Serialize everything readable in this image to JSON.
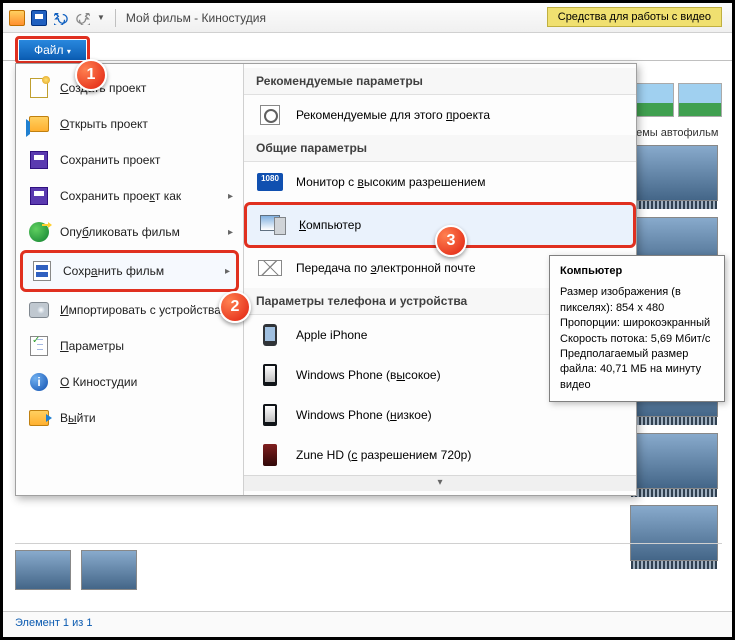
{
  "title": "Мой фильм - Киностудия",
  "tool_tab": "Средства для работы с видео",
  "file_button": "Файл",
  "thumbs_header": "Темы автофильм",
  "status": "Элемент 1 из 1",
  "file_menu": {
    "left": [
      {
        "id": "new",
        "label": "Создать проект",
        "u": "С"
      },
      {
        "id": "open",
        "label": "Открыть проект",
        "u": "О"
      },
      {
        "id": "save",
        "label": "Сохранить проект"
      },
      {
        "id": "saveas",
        "label": "Сохранить проект как",
        "u": "к",
        "arrow": true
      },
      {
        "id": "publish",
        "label": "Опубликовать фильм",
        "u": "б",
        "arrow": true
      },
      {
        "id": "savefilm",
        "label": "Сохранить фильм",
        "u": "а",
        "arrow": true,
        "hl": true
      },
      {
        "id": "import",
        "label": "Импортировать с устройства",
        "u": "И"
      },
      {
        "id": "settings",
        "label": "Параметры",
        "u": "П"
      },
      {
        "id": "about",
        "label": "О Киностудии",
        "u": "О"
      },
      {
        "id": "exit",
        "label": "Выйти",
        "u": "ы"
      }
    ],
    "sections": [
      {
        "title": "Рекомендуемые параметры",
        "items": [
          {
            "id": "recommended",
            "label": "Рекомендуемые для этого проекта",
            "u": "п"
          }
        ]
      },
      {
        "title": "Общие параметры",
        "items": [
          {
            "id": "hd",
            "label": "Монитор с высоким разрешением",
            "u": "в"
          },
          {
            "id": "computer",
            "label": "Компьютер",
            "u": "К",
            "hl": true
          },
          {
            "id": "email",
            "label": "Передача по электронной почте",
            "u": "э"
          }
        ]
      },
      {
        "title": "Параметры телефона и устройства",
        "items": [
          {
            "id": "iphone",
            "label": "Apple iPhone"
          },
          {
            "id": "wp_high",
            "label": "Windows Phone (высокое)",
            "u": "ы"
          },
          {
            "id": "wp_low",
            "label": "Windows Phone (низкое)",
            "u": "н"
          },
          {
            "id": "zune",
            "label": "Zune HD (с разрешением 720p)",
            "u": "с"
          }
        ]
      }
    ]
  },
  "tooltip": {
    "title": "Компьютер",
    "lines": [
      "Размер изображения (в пикселях): 854 x 480",
      "Пропорции: широкоэкранный",
      "Скорость потока: 5,69 Мбит/с",
      "Предполагаемый размер файла: 40,71 МБ на минуту видео"
    ]
  },
  "steps": {
    "1": "1",
    "2": "2",
    "3": "3"
  }
}
